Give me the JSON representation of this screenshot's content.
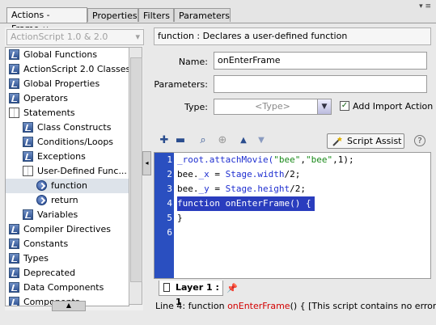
{
  "tabs": [
    {
      "label": "Actions - Frame",
      "active": true,
      "close": "×"
    },
    {
      "label": "Properties"
    },
    {
      "label": "Filters"
    },
    {
      "label": "Parameters"
    }
  ],
  "window_controls": "▾ ≡",
  "version_select": {
    "value": "ActionScript 1.0 & 2.0",
    "arrow": "▾"
  },
  "tree": [
    {
      "label": "Global Functions",
      "icon": "book"
    },
    {
      "label": "ActionScript 2.0 Classes",
      "icon": "book"
    },
    {
      "label": "Global Properties",
      "icon": "book"
    },
    {
      "label": "Operators",
      "icon": "book"
    },
    {
      "label": "Statements",
      "icon": "open-book"
    },
    {
      "label": "Class Constructs",
      "icon": "book"
    },
    {
      "label": "Conditions/Loops",
      "icon": "book"
    },
    {
      "label": "Exceptions",
      "icon": "book"
    },
    {
      "label": "User-Defined Func...",
      "icon": "open-book"
    },
    {
      "label": "function",
      "icon": "function"
    },
    {
      "label": "return",
      "icon": "function"
    },
    {
      "label": "Variables",
      "icon": "book"
    },
    {
      "label": "Compiler Directives",
      "icon": "book"
    },
    {
      "label": "Constants",
      "icon": "book"
    },
    {
      "label": "Types",
      "icon": "book"
    },
    {
      "label": "Deprecated",
      "icon": "book"
    },
    {
      "label": "Data Components",
      "icon": "book"
    },
    {
      "label": "Components",
      "icon": "book"
    }
  ],
  "description": "function : Declares a user-defined function",
  "form": {
    "name_label": "Name:",
    "name_value": "onEnterFrame",
    "parameters_label": "Parameters:",
    "parameters_value": "",
    "type_label": "Type:",
    "type_placeholder": "<Type>",
    "import_label": "Add Import Action for",
    "import_checked": true
  },
  "toolbar": {
    "add_icon": "plus-icon",
    "remove_icon": "minus-icon",
    "find_icon": "find-icon",
    "target_icon": "target-icon",
    "up_icon": "arrow-up-icon",
    "down_icon": "arrow-down-icon",
    "script_assist": "Script Assist",
    "help": "?"
  },
  "code": {
    "line_numbers": [
      "1",
      "2",
      "3",
      "4",
      "5",
      "6"
    ],
    "lines": [
      {
        "parts": [
          {
            "t": "_root.attachMovie(",
            "c": "kw"
          },
          {
            "t": "\"bee\"",
            "c": "str"
          },
          {
            "t": ",",
            "c": ""
          },
          {
            "t": "\"bee\"",
            "c": "str"
          },
          {
            "t": ",1);",
            "c": ""
          }
        ]
      },
      {
        "parts": [
          {
            "t": "bee.",
            "c": ""
          },
          {
            "t": "_x",
            "c": "kw"
          },
          {
            "t": " = ",
            "c": ""
          },
          {
            "t": "Stage.width",
            "c": "kw"
          },
          {
            "t": "/2;",
            "c": ""
          }
        ]
      },
      {
        "parts": [
          {
            "t": "bee.",
            "c": ""
          },
          {
            "t": "_y",
            "c": "kw"
          },
          {
            "t": " = ",
            "c": ""
          },
          {
            "t": "Stage.height",
            "c": "kw"
          },
          {
            "t": "/2;",
            "c": ""
          }
        ]
      },
      {
        "parts": [
          {
            "t": "function onEnterFrame() {",
            "c": ""
          }
        ],
        "highlighted": true
      },
      {
        "parts": [
          {
            "t": "}",
            "c": ""
          }
        ]
      },
      {
        "parts": []
      }
    ]
  },
  "layer_tab": "Layer 1 : 1",
  "status": {
    "prefix": "Line 4: function ",
    "function_name": "onEnterFrame",
    "suffix": "() { [This script contains no errors.]"
  },
  "colors": {
    "gutter": "#2a4fc0",
    "highlight": "#2a3dbe",
    "keyword": "#1f2fd0",
    "string": "#1a8a1a",
    "status_function": "#d20000"
  }
}
